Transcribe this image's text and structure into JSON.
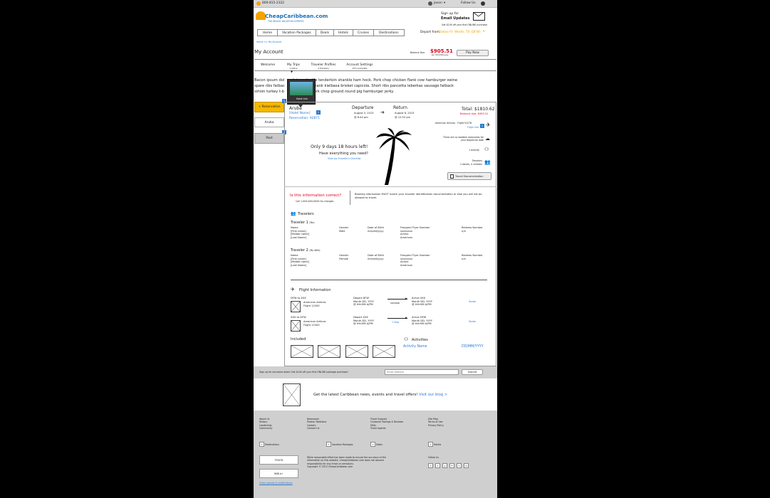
{
  "topbar": {
    "phone": "800-815-2322",
    "user": "Jason",
    "follow": "Follow Us"
  },
  "logo": {
    "name": "CheapCaribbean.com",
    "tagline": "THE BEACH VACATION EXPERTS"
  },
  "signup": {
    "line1": "Sign up for",
    "line2": "Email Updates",
    "note": "Get $100 off your first ONLINE purchase"
  },
  "nav": [
    "Home",
    "Vacation Packages",
    "Deals",
    "Hotels",
    "Cruises",
    "Destinations"
  ],
  "depart": {
    "label": "Depart from",
    "value": "Dallas-Ft. Worth, TX (DFW)"
  },
  "breadcrumb": "Home >> My Account",
  "account": {
    "title": "My Account",
    "balance_label": "Balance Due",
    "balance": "$905.51",
    "balance_note": "by mm/dd/yyyy",
    "pay_button": "Pay Now"
  },
  "tabs": [
    {
      "label": "Welcome",
      "sub": ""
    },
    {
      "label": "My Trips",
      "sub": "1 Active"
    },
    {
      "label": "Traveler Profiles",
      "sub": "2 Travelers"
    },
    {
      "label": "Account Settings",
      "sub": "67% Complete"
    }
  ],
  "intro": [
    "Bacon ipsum dol",
    "loin andouille tenderloin shankle ham hock. Pork chop chicken flank cow hamburger swine",
    "spare ribs fatbac",
    "sage rump shank kielbasa brisket capicola. Short ribs pancetta leberkas sausage fatback",
    "sirloin turkey t-b",
    "strip steak pork chop ground round pig hamburger jerky."
  ],
  "hotel_popup": "Hotel Link",
  "side_tabs": {
    "reservation": "+ Reservation",
    "aruba": "Aruba",
    "past": "Past"
  },
  "badges": {
    "b1": "1",
    "b2": "1",
    "b3": "2",
    "b4": "1"
  },
  "trip": {
    "destination": "Aruba",
    "hotel": "[Hotel Name]",
    "reservation": "Reservation: 92871",
    "departure_label": "Departure",
    "departure_date": "August 5, 2013",
    "departure_time": "@ 6:40 pm",
    "return_label": "Return",
    "return_date": "August 8, 2013",
    "return_time": "@ 12:52 pm",
    "total": "Total: $1810.62",
    "balance_due": "Balance due: $905.51",
    "countdown": "Only 9 days 18 hours left!",
    "question": "Have everything you need?",
    "checklist": "View our Traveller's Checklist",
    "airline": "American Airlines - Flight 91278",
    "flight_info": "Flight Info",
    "weather": "There are no weather advisories for your departure date",
    "activity": "1 Activity",
    "travelers_label": "Travelers",
    "travelers_count": "2 Adults, 0 children",
    "travel_doc": "Travel Documentation"
  },
  "correct": {
    "question": "Is this information correct?",
    "call": "Call 1-XXX-XXX-XXXX for changes",
    "note": "Booking information MUST match your traveler identification documentation or else you will not be allowed to travel."
  },
  "travelers": {
    "heading": "Travelers",
    "headers": {
      "name": "Name",
      "gender": "Gender",
      "dob": "Date of Birth",
      "ff": "Frequent Flyer Number",
      "redress": "Redress Number"
    },
    "list": [
      {
        "title": "Traveler 1",
        "tag": "(Me)",
        "first": "[First name]",
        "middle": "[Middle name]",
        "last": "[Last Name]",
        "gender": "Male",
        "dob": "mm/dd/yyyy",
        "ff": "xxxxxxxx",
        "airline": "Airline",
        "carrier": "American",
        "redress": "n/a"
      },
      {
        "title": "Traveler 2",
        "tag": "(My Wife)",
        "first": "[First name]",
        "middle": "[Middle name]",
        "last": "[Last Name]",
        "gender": "Female",
        "dob": "mm/dd/yyyy",
        "ff": "xxxxxxxx",
        "airline": "Airline",
        "carrier": "American",
        "redress": "n/a"
      }
    ]
  },
  "flights": {
    "heading": "Flight Information",
    "list": [
      {
        "route": "DFW to XXX",
        "airline": "American Airlines",
        "flight": "Flight 12345",
        "depart": "Depart DFW",
        "depart_date": "Month DD, YYYY",
        "depart_time": "@ HH:MM A/PM",
        "stops": "nonstop",
        "arrive": "Arrive XXX",
        "arrive_date": "Month DD, YYYY",
        "arrive_time": "@ HH:MM A/PM",
        "seats": "Seats"
      },
      {
        "route": "XXX to DFW",
        "airline": "American Airlines",
        "flight": "Flight 12345",
        "depart": "Depart XXX",
        "depart_date": "Month DD, YYYY",
        "depart_time": "@ HH:MM A/PM",
        "stops": "1 Stop",
        "arrive": "Arrive DFW",
        "arrive_date": "Month DD, YYYY",
        "arrive_time": "@ HH:MM A/PM",
        "seats": "Seats"
      }
    ]
  },
  "included": {
    "heading": "Included"
  },
  "activities": {
    "heading": "Activities",
    "name": "Activity Name",
    "date": "DD/MM/YYYY"
  },
  "email_bar": {
    "text": "Sign up for exclusive deals! Get $100 off your first ONLINE package purchase!",
    "placeholder": "Email Address",
    "submit": "Submit"
  },
  "blog": {
    "text": "Get the latest Caribbean news, events and travel offers!",
    "link": "Visit our blog >"
  },
  "footer": {
    "col1": [
      "About Us",
      "History",
      "Leadership",
      "Community"
    ],
    "col2": [
      "Newsroom",
      "Partner Relations",
      "Careers",
      "Contact Us"
    ],
    "col3": [
      "Travel Support",
      "Customer Ratings & Reviews",
      "FAQs",
      "Travel Agents"
    ],
    "col4": [
      "Site Map",
      "Terms of Use",
      "Privacy Policy"
    ],
    "expanders": [
      "Destinations",
      "Vacation Packages",
      "Deals",
      "Hotels"
    ],
    "trust": "TRUSTe",
    "bbb": "BBB A+",
    "awards": "Other awards & certifications",
    "disclaimer": [
      "While reasonable effort has been made to ensure the accuracy of the",
      "information on this website, CheapCaribbean.com does not assume",
      "responsibility for any errors or omissions.",
      "Copyright © 2013 CheapCaribbean.com"
    ],
    "follow": "Follow Us",
    "social": [
      "f",
      "t",
      "y",
      "P",
      "+",
      "G"
    ]
  }
}
